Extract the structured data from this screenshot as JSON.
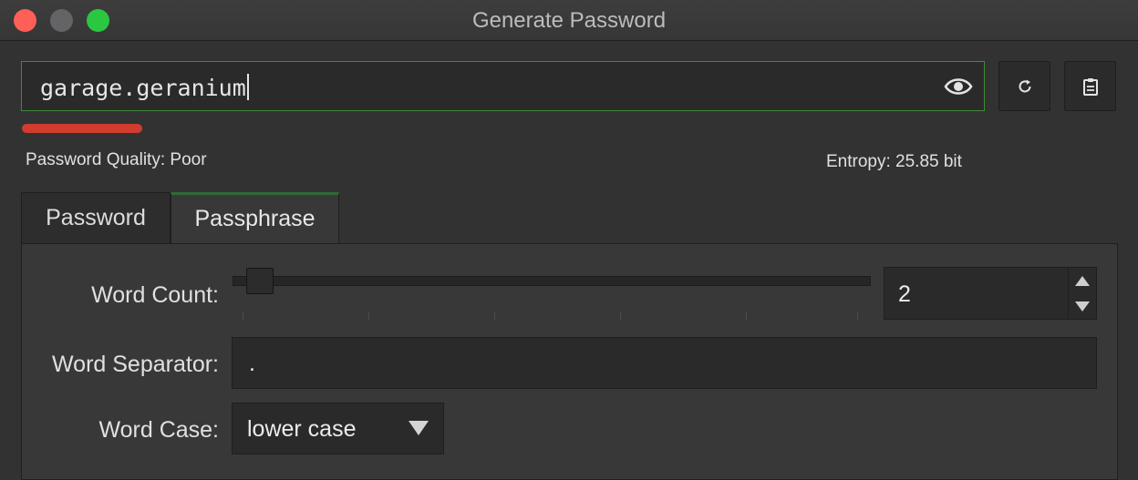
{
  "window": {
    "title": "Generate Password"
  },
  "password": {
    "value": "garage.geranium"
  },
  "quality": {
    "label": "Password Quality: Poor",
    "color": "#d13c2e"
  },
  "entropy": {
    "label": "Entropy: 25.85 bit"
  },
  "tabs": [
    {
      "label": "Password",
      "active": false
    },
    {
      "label": "Passphrase",
      "active": true
    }
  ],
  "passphrase": {
    "word_count_label": "Word Count:",
    "word_count_value": "2",
    "word_separator_label": "Word Separator:",
    "word_separator_value": ".",
    "word_case_label": "Word Case:",
    "word_case_value": "lower case"
  },
  "icons": {
    "reveal": "eye-icon",
    "regenerate": "refresh-icon",
    "copy": "clipboard-icon",
    "spin_up": "triangle-up-icon",
    "spin_down": "triangle-down-icon",
    "dropdown": "triangle-down-icon"
  },
  "colors": {
    "accent": "#3f8a3a",
    "window_bg": "#323233"
  }
}
